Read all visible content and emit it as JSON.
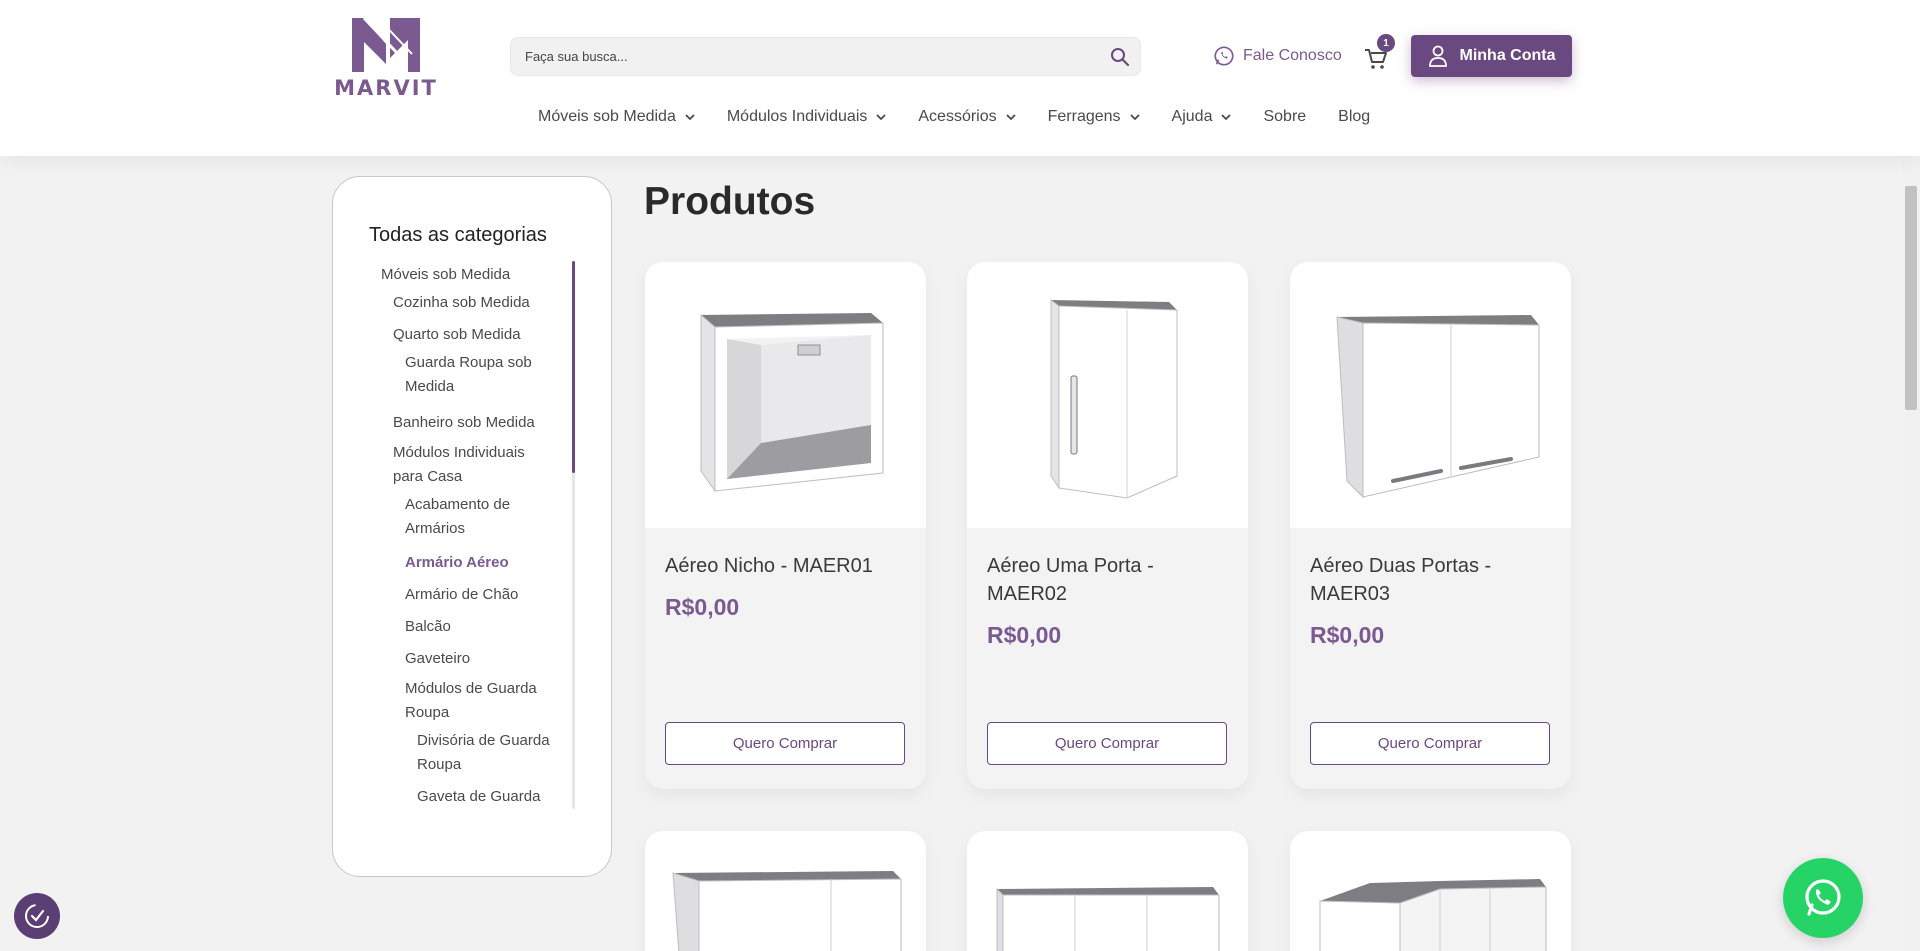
{
  "brand": {
    "name": "MARVIT",
    "accent": "#6a4880",
    "price_color": "#7b5a92"
  },
  "header": {
    "search_placeholder": "Faça sua busca...",
    "contact_label": "Fale Conosco",
    "cart_count": "1",
    "account_label": "Minha Conta"
  },
  "nav": {
    "items": [
      {
        "label": "Móveis sob Medida",
        "has_dropdown": true
      },
      {
        "label": "Módulos Individuais",
        "has_dropdown": true
      },
      {
        "label": "Acessórios",
        "has_dropdown": true
      },
      {
        "label": "Ferragens",
        "has_dropdown": true
      },
      {
        "label": "Ajuda",
        "has_dropdown": true
      },
      {
        "label": "Sobre",
        "has_dropdown": false
      },
      {
        "label": "Blog",
        "has_dropdown": false
      }
    ]
  },
  "sidebar": {
    "title": "Todas as categorias",
    "categories": [
      {
        "label": "Móveis sob Medida",
        "level": 0,
        "active": false
      },
      {
        "label": "Cozinha sob Medida",
        "level": 1,
        "active": false
      },
      {
        "label": "Quarto sob Medida",
        "level": 1,
        "active": false
      },
      {
        "label": "Guarda Roupa sob Medida",
        "level": 2,
        "active": false
      },
      {
        "label": "Banheiro sob Medida",
        "level": 1,
        "active": false
      },
      {
        "label": "Módulos Individuais para Casa",
        "level": 1,
        "active": false
      },
      {
        "label": "Acabamento de Armários",
        "level": 2,
        "active": false
      },
      {
        "label": "Armário Aéreo",
        "level": 2,
        "active": true
      },
      {
        "label": "Armário de Chão",
        "level": 2,
        "active": false
      },
      {
        "label": "Balcão",
        "level": 2,
        "active": false
      },
      {
        "label": "Gaveteiro",
        "level": 2,
        "active": false
      },
      {
        "label": "Módulos de Guarda Roupa",
        "level": 2,
        "active": false
      },
      {
        "label": "Divisória de Guarda Roupa",
        "level": 3,
        "active": false
      },
      {
        "label": "Gaveta de Guarda Roupa",
        "level": 3,
        "active": false
      }
    ]
  },
  "main": {
    "title": "Produtos",
    "products": [
      {
        "name": "Aéreo Nicho - MAER01",
        "price": "R$0,00",
        "button": "Quero Comprar",
        "image_icon": "cabinet-niche-image"
      },
      {
        "name": "Aéreo Uma Porta - MAER02",
        "price": "R$0,00",
        "button": "Quero Comprar",
        "image_icon": "cabinet-one-door-image"
      },
      {
        "name": "Aéreo Duas Portas - MAER03",
        "price": "R$0,00",
        "button": "Quero Comprar",
        "image_icon": "cabinet-two-doors-image"
      }
    ]
  }
}
